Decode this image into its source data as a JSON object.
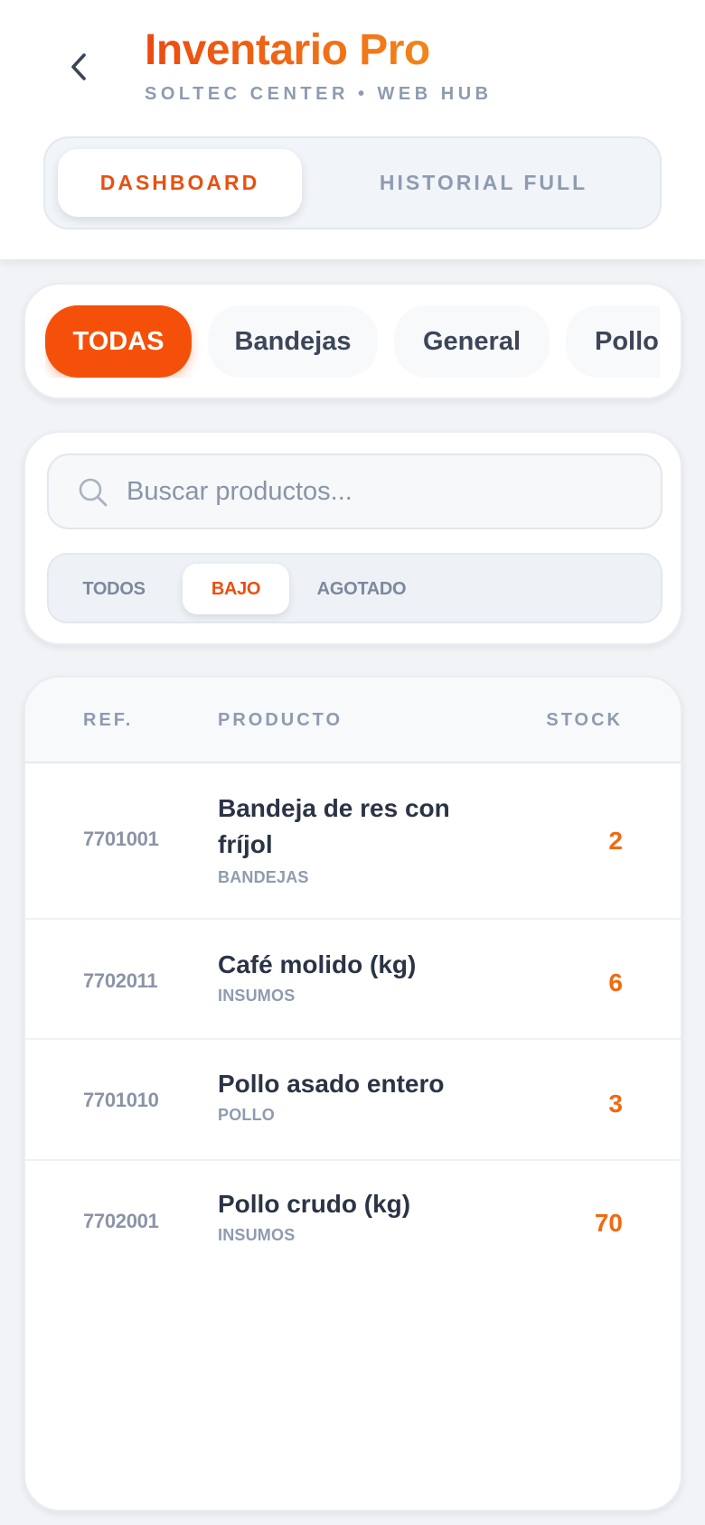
{
  "header": {
    "title": "Inventario Pro",
    "subtitle": "SOLTEC CENTER • WEB HUB",
    "tabs": [
      {
        "label": "DASHBOARD",
        "active": true
      },
      {
        "label": "HISTORIAL FULL",
        "active": false
      }
    ]
  },
  "categories": {
    "items": [
      {
        "label": "TODAS",
        "active": true
      },
      {
        "label": "Bandejas",
        "active": false
      },
      {
        "label": "General",
        "active": false
      },
      {
        "label": "Pollo",
        "active": false
      }
    ]
  },
  "search": {
    "placeholder": "Buscar productos...",
    "value": ""
  },
  "stock_filter": {
    "tabs": [
      {
        "label": "TODOS",
        "active": false
      },
      {
        "label": "BAJO",
        "active": true
      },
      {
        "label": "AGOTADO",
        "active": false
      }
    ]
  },
  "table": {
    "columns": {
      "ref": "REF.",
      "product": "PRODUCTO",
      "stock": "STOCK"
    },
    "rows": [
      {
        "ref": "7701001",
        "name": "Bandeja de res con fríjol",
        "category": "BANDEJAS",
        "stock": "2"
      },
      {
        "ref": "7702011",
        "name": "Café molido (kg)",
        "category": "INSUMOS",
        "stock": "6"
      },
      {
        "ref": "7701010",
        "name": "Pollo asado entero",
        "category": "POLLO",
        "stock": "3"
      },
      {
        "ref": "7702001",
        "name": "Pollo crudo (kg)",
        "category": "INSUMOS",
        "stock": "70"
      }
    ]
  },
  "colors": {
    "accent": "#f5500a",
    "accent_text": "#e9500f",
    "stock_low": "#f06a10",
    "background": "#f1f3f6",
    "muted": "#8e9bb0"
  }
}
